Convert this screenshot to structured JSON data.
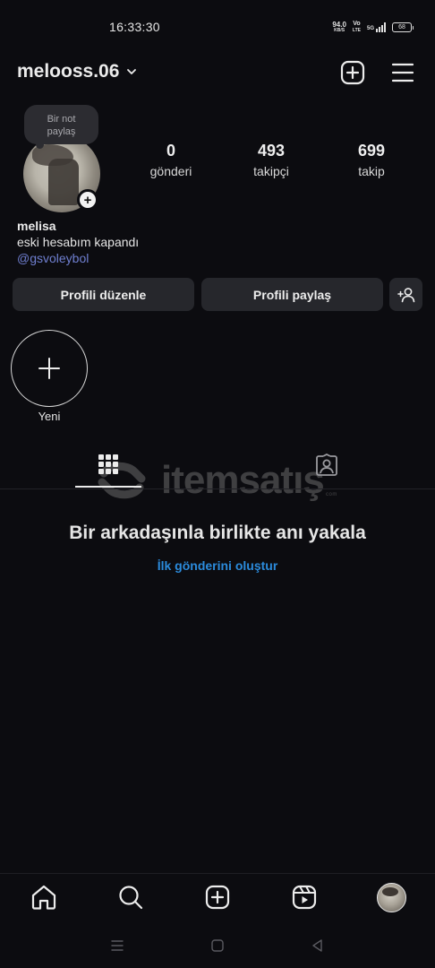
{
  "status_bar": {
    "time": "16:33:30",
    "net_speed": "94.0",
    "net_unit": "KB/S",
    "volte": "Vo",
    "volte_sub": "LTE",
    "signal_label": "5G",
    "battery": "68"
  },
  "header": {
    "username": "melooss.06",
    "icons": [
      "chevron-down-icon",
      "add-post-icon",
      "menu-icon"
    ]
  },
  "note": {
    "text_line1": "Bir not",
    "text_line2": "paylaş"
  },
  "stats": [
    {
      "value": "0",
      "label": "gönderi"
    },
    {
      "value": "493",
      "label": "takipçi"
    },
    {
      "value": "699",
      "label": "takip"
    }
  ],
  "bio": {
    "name": "melisa",
    "text": "eski hesabım kapandı",
    "link": "@gsvoleybol"
  },
  "buttons": {
    "edit_profile": "Profili düzenle",
    "share_profile": "Profili paylaş",
    "discover_people_icon": "add-person-icon"
  },
  "highlights": {
    "new_label": "Yeni"
  },
  "tabs": {
    "items": [
      "grid-icon",
      "tagged-icon"
    ],
    "active": "grid-icon"
  },
  "watermark": {
    "text": "itemsatış",
    "sub": "com"
  },
  "empty_state": {
    "title": "Bir arkadaşınla birlikte anı yakala",
    "link": "İlk gönderini oluştur"
  },
  "bottom_nav": [
    "home-icon",
    "search-icon",
    "create-icon",
    "reels-icon",
    "profile-avatar"
  ],
  "colors": {
    "background": "#0c0c10",
    "button": "#26272c",
    "link_blue": "#2b8bdc",
    "bio_link": "#6f7fd0"
  }
}
